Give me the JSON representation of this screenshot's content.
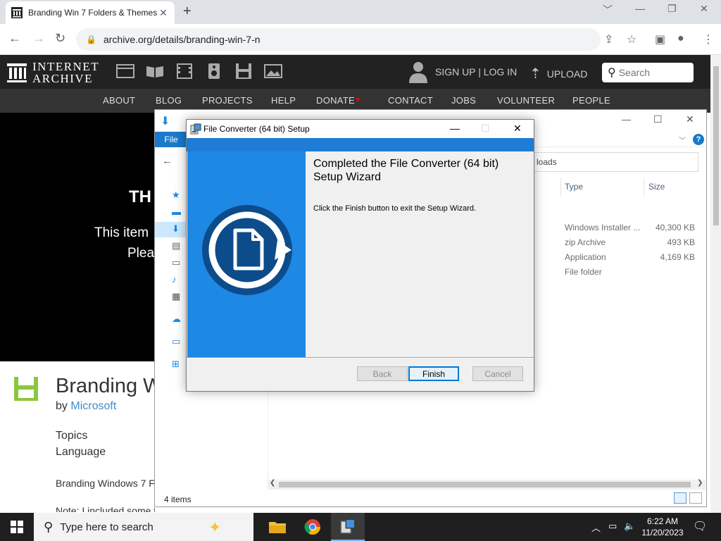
{
  "browser": {
    "tab_title": "Branding Win 7 Folders & Themes",
    "tab_close": "✕",
    "new_tab": "+",
    "url": "archive.org/details/branding-win-7-n",
    "minimize": "﹀",
    "min": "—",
    "restore": "❐",
    "close": "✕"
  },
  "ia": {
    "logo_line1": "INTERNET",
    "logo_line2": "ARCHIVE",
    "signup": "SIGN UP | LOG IN",
    "upload": "UPLOAD",
    "search_placeholder": "Search",
    "nav": [
      "ABOUT",
      "BLOG",
      "PROJECTS",
      "HELP",
      "DONATE",
      "CONTACT",
      "JOBS",
      "VOLUNTEER",
      "PEOPLE"
    ],
    "banner_th": "TH",
    "banner_l1": "This item",
    "banner_l2": "Plea",
    "item_title": "Branding W",
    "by_label": "by",
    "by_author": "Microsoft",
    "topics": "Topics",
    "language": "Language",
    "description": "Branding Windows 7 F",
    "note": "Note: I included some themes I created. You must take ownership of the system files"
  },
  "explorer": {
    "file_tab": "File",
    "address": "loads",
    "col_type": "Type",
    "col_size": "Size",
    "rows": [
      {
        "type": "Windows Installer ...",
        "size": "40,300 KB"
      },
      {
        "type": "zip Archive",
        "size": "493 KB"
      },
      {
        "type": "Application",
        "size": "4,169 KB"
      },
      {
        "type": "File folder",
        "size": ""
      }
    ],
    "status": "4 items",
    "help": "?"
  },
  "setup": {
    "title": "File Converter (64 bit) Setup",
    "heading": "Completed the File Converter (64 bit) Setup Wizard",
    "body": "Click the Finish button to exit the Setup Wizard.",
    "back": "Back",
    "finish": "Finish",
    "cancel": "Cancel"
  },
  "taskbar": {
    "search_placeholder": "Type here to search",
    "time": "6:22 AM",
    "date": "11/20/2023"
  },
  "colors": {
    "setup_blue": "#1e88e5",
    "explorer_file_blue": "#1979ca",
    "ia_dark": "#222222"
  }
}
